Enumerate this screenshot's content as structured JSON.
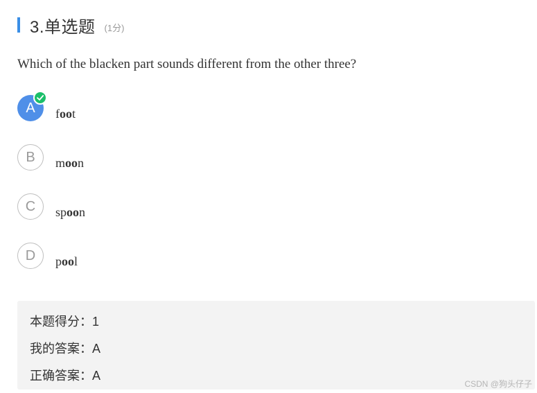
{
  "question": {
    "title": "3.单选题",
    "score": "(1分)",
    "stem": "Which of the blacken part sounds different from the other three?"
  },
  "options": [
    {
      "letter": "A",
      "pre": "f",
      "bold": "oo",
      "post": "t",
      "selected": true
    },
    {
      "letter": "B",
      "pre": "m",
      "bold": "oo",
      "post": "n",
      "selected": false
    },
    {
      "letter": "C",
      "pre": "sp",
      "bold": "oo",
      "post": "n",
      "selected": false
    },
    {
      "letter": "D",
      "pre": "p",
      "bold": "oo",
      "post": "l",
      "selected": false
    }
  ],
  "result": {
    "score_label": "本题得分：",
    "score_value": "1",
    "my_answer_label": "我的答案：",
    "my_answer_value": "A",
    "correct_answer_label": "正确答案：",
    "correct_answer_value": "A"
  },
  "watermark": "CSDN @狗头仔子",
  "colors": {
    "accent_bar": "#3a8ee6",
    "selected_option": "#4f8fe8",
    "check_badge": "#1bbf6a",
    "result_bg": "#f3f3f3"
  },
  "icons": {
    "selected_badge": "checkmark-icon"
  }
}
